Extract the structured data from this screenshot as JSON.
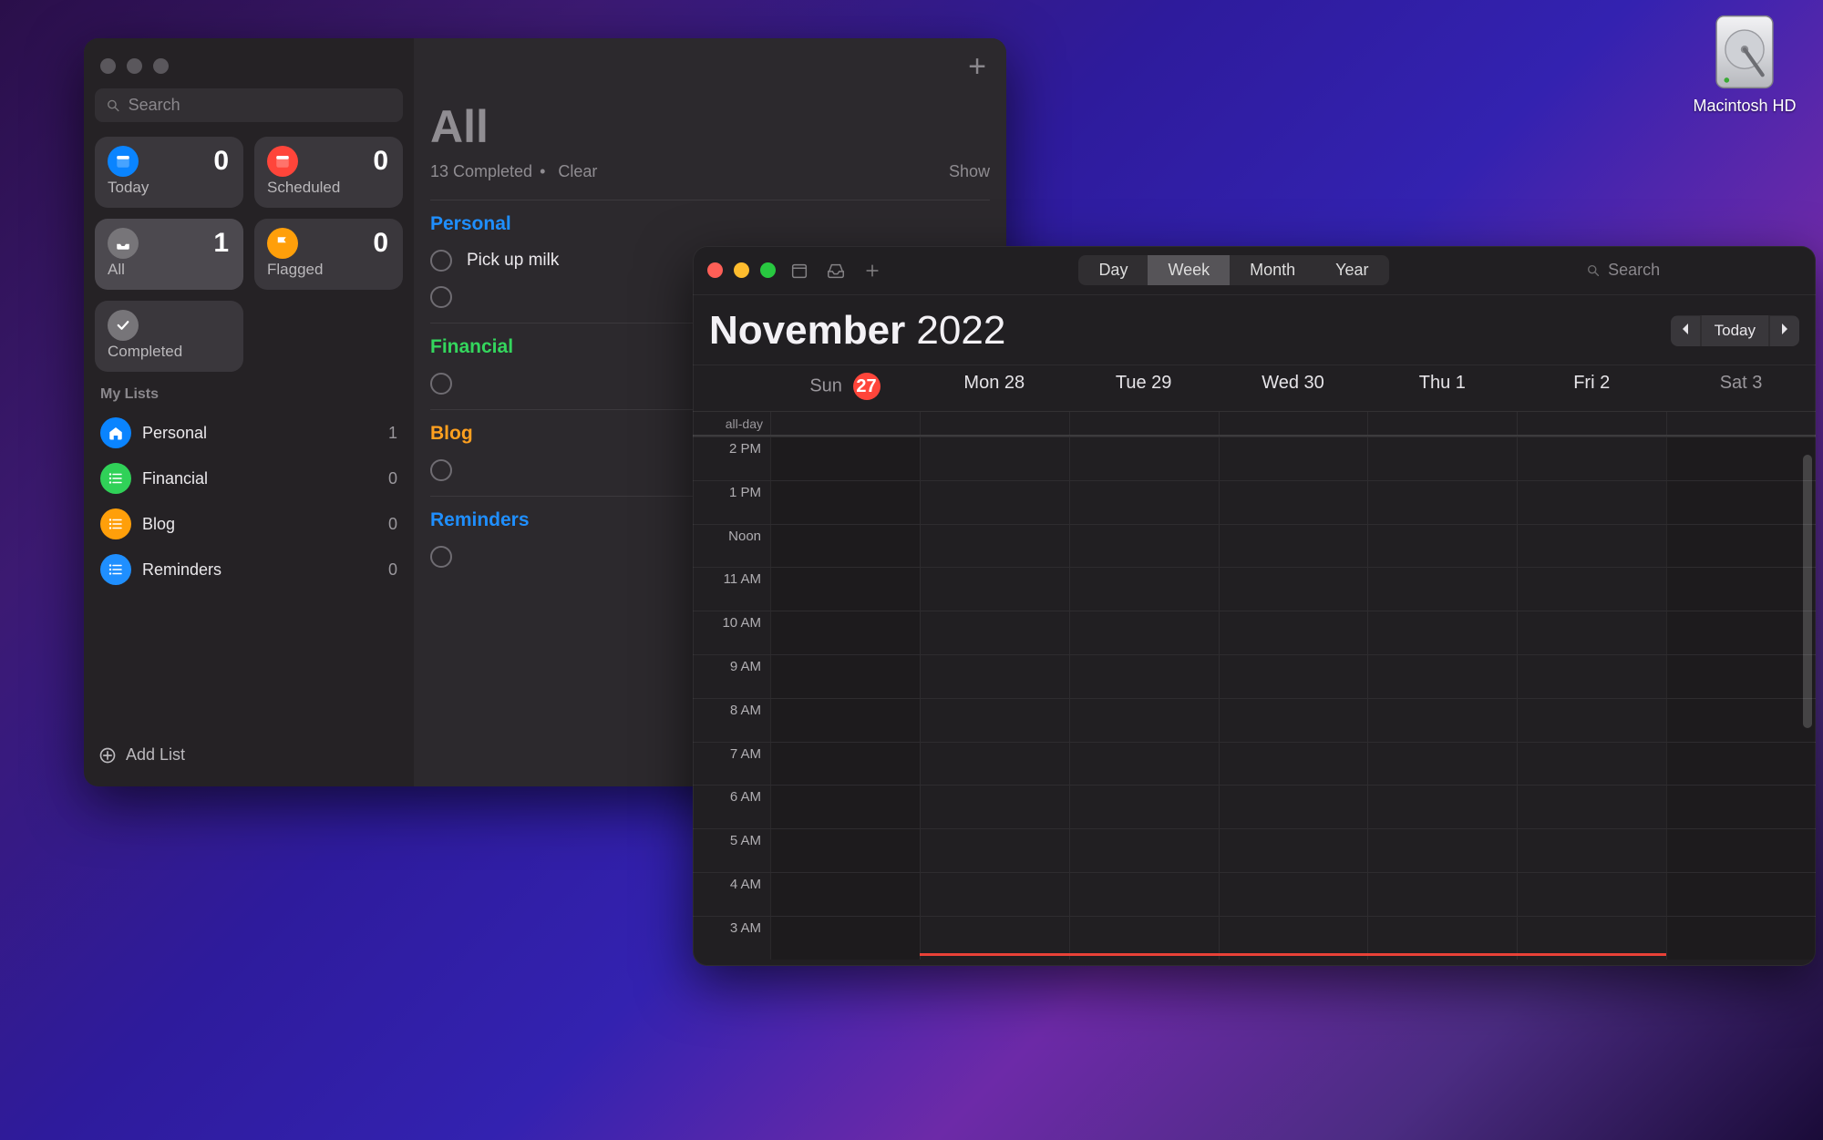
{
  "desktop": {
    "hd_label": "Macintosh HD"
  },
  "reminders": {
    "search_placeholder": "Search",
    "smart": {
      "today": {
        "label": "Today",
        "count": "0"
      },
      "scheduled": {
        "label": "Scheduled",
        "count": "0"
      },
      "all": {
        "label": "All",
        "count": "1"
      },
      "flagged": {
        "label": "Flagged",
        "count": "0"
      },
      "completed": {
        "label": "Completed"
      }
    },
    "mylists_header": "My Lists",
    "lists": [
      {
        "name": "Personal",
        "count": "1",
        "color": "#0a84ff",
        "icon": "home"
      },
      {
        "name": "Financial",
        "count": "0",
        "color": "#30d158",
        "icon": "list"
      },
      {
        "name": "Blog",
        "count": "0",
        "color": "#ff9f0a",
        "icon": "list"
      },
      {
        "name": "Reminders",
        "count": "0",
        "color": "#1f8fff",
        "icon": "list"
      }
    ],
    "add_list_label": "Add List",
    "main": {
      "title": "All",
      "completed_text": "13 Completed",
      "bullet": "•",
      "clear_label": "Clear",
      "show_label": "Show",
      "sections": [
        {
          "title": "Personal",
          "class": "c-blue",
          "items": [
            "Pick up milk",
            ""
          ]
        },
        {
          "title": "Financial",
          "class": "c-green",
          "items": [
            ""
          ]
        },
        {
          "title": "Blog",
          "class": "c-orange",
          "items": [
            ""
          ]
        },
        {
          "title": "Reminders",
          "class": "c-blue",
          "items": [
            ""
          ]
        }
      ]
    }
  },
  "calendar": {
    "views": {
      "day": "Day",
      "week": "Week",
      "month": "Month",
      "year": "Year",
      "active": "week"
    },
    "search_placeholder": "Search",
    "month": "November",
    "year": "2022",
    "today_label": "Today",
    "days": [
      {
        "label": "Sun",
        "num": "27",
        "today": true,
        "weekend": true
      },
      {
        "label": "Mon",
        "num": "28",
        "today": false,
        "weekend": false
      },
      {
        "label": "Tue",
        "num": "29",
        "today": false,
        "weekend": false
      },
      {
        "label": "Wed",
        "num": "30",
        "today": false,
        "weekend": false
      },
      {
        "label": "Thu",
        "num": "1",
        "today": false,
        "weekend": false
      },
      {
        "label": "Fri",
        "num": "2",
        "today": false,
        "weekend": false
      },
      {
        "label": "Sat",
        "num": "3",
        "today": false,
        "weekend": true
      }
    ],
    "allday_label": "all-day",
    "hours": [
      "3 AM",
      "4 AM",
      "5 AM",
      "6 AM",
      "7 AM",
      "8 AM",
      "9 AM",
      "10 AM",
      "11 AM",
      "Noon",
      "1 PM",
      "2 PM"
    ]
  }
}
